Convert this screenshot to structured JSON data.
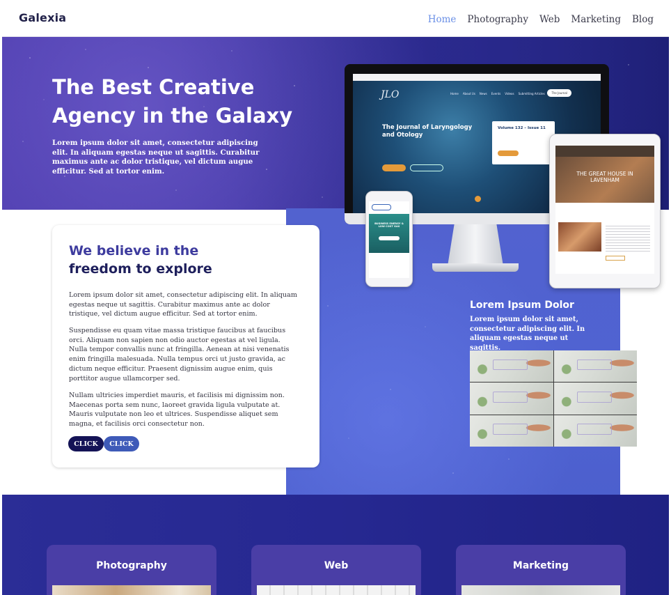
{
  "brand": "Galexia",
  "nav": {
    "items": [
      {
        "label": "Home",
        "active": true
      },
      {
        "label": "Photography",
        "active": false
      },
      {
        "label": "Web",
        "active": false
      },
      {
        "label": "Marketing",
        "active": false
      },
      {
        "label": "Blog",
        "active": false
      }
    ]
  },
  "hero": {
    "title_line1": "The Best Creative",
    "title_line2": "Agency in the Galaxy",
    "text": "Lorem ipsum dolor sit amet, consectetur adipiscing elit. In aliquam egestas neque ut sagittis. Curabitur maximus ante ac dolor tristique, vel dictum augue efficitur. Sed at tortor enim."
  },
  "card": {
    "title_line1": "We believe in the",
    "title_line2": "freedom to explore",
    "paragraphs": [
      "Lorem ipsum dolor sit amet, consectetur adipiscing elit. In aliquam egestas neque ut sagittis. Curabitur maximus ante ac dolor tristique, vel dictum augue efficitur. Sed at tortor enim.",
      "Suspendisse eu quam vitae massa tristique faucibus at faucibus orci. Aliquam non sapien non odio auctor egestas at vel ligula. Nulla tempor convallis nunc at fringilla. Aenean at nisi venenatis enim fringilla malesuada. Nulla tempus orci ut justo gravida, ac dictum neque efficitur. Praesent dignissim augue enim, quis porttitor augue ullamcorper sed.",
      "Nullam ultricies imperdiet mauris, et facilisis mi dignissim non. Maecenas porta sem nunc, laoreet gravida ligula vulputate at. Mauris vulputate non leo et ultrices. Suspendisse aliquet sem magna, et facilisis orci consectetur non."
    ],
    "button1": "CLICK",
    "button2": "CLICK"
  },
  "mockup": {
    "screen_title": "The Journal of Laryngology and Otology",
    "volume": "Volume 132 – Issue 11",
    "tablet_title": "THE GREAT HOUSE IN LAVENHAM",
    "phone_title": "BUSINESS ENERGY & LOW COST GAS"
  },
  "feature": {
    "title": "Lorem Ipsum Dolor",
    "text": "Lorem ipsum dolor sit amet, consectetur adipiscing elit. In aliquam egestas neque ut sagittis."
  },
  "services": [
    {
      "title": "Photography"
    },
    {
      "title": "Web"
    },
    {
      "title": "Marketing"
    }
  ],
  "colors": {
    "hero_bg": "#3e33a2",
    "panel_blue": "#5262cf",
    "band": "#262891",
    "nav_active": "#6a8fe6",
    "button_dark": "#141356",
    "button_blue": "#3e5ab8"
  }
}
